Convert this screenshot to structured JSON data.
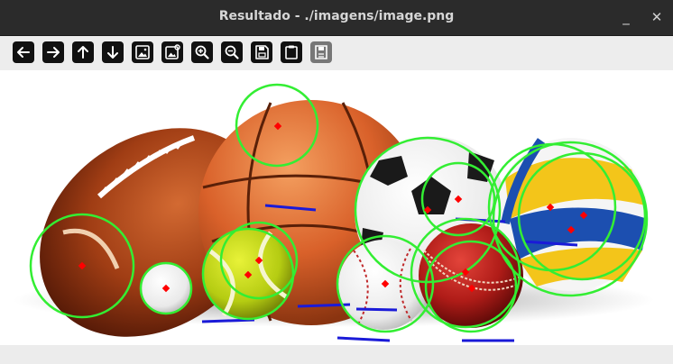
{
  "window": {
    "title": "Resultado - ./imagens/image.png"
  },
  "window_controls": {
    "minimize_glyph": "_",
    "close_glyph": "✕"
  },
  "toolbar": {
    "buttons": [
      {
        "name": "back-icon",
        "enabled": true
      },
      {
        "name": "forward-icon",
        "enabled": true
      },
      {
        "name": "up-icon",
        "enabled": true
      },
      {
        "name": "down-icon",
        "enabled": true
      },
      {
        "name": "image-icon",
        "enabled": true
      },
      {
        "name": "image-edit-icon",
        "enabled": true
      },
      {
        "name": "zoom-in-icon",
        "enabled": true
      },
      {
        "name": "zoom-out-icon",
        "enabled": true
      },
      {
        "name": "save-icon",
        "enabled": true
      },
      {
        "name": "clipboard-icon",
        "enabled": true
      },
      {
        "name": "floppy-disabled-icon",
        "enabled": false
      }
    ]
  },
  "image": {
    "subject": "sports balls with detected circles",
    "detection_color": "#33ee33",
    "center_marker_color": "#ff0000",
    "shadow_line_color": "#1a1ad8"
  }
}
